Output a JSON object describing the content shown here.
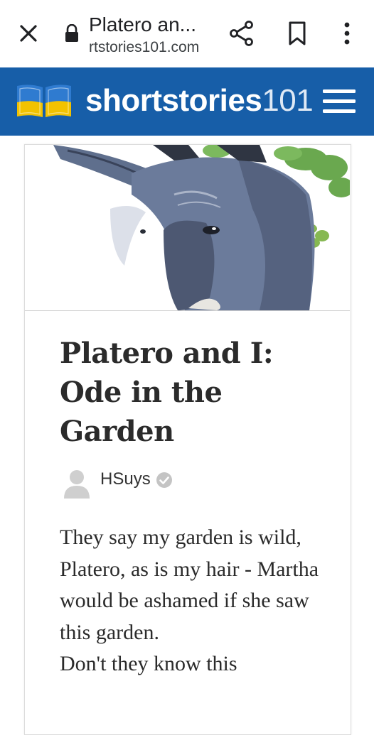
{
  "browser": {
    "title": "Platero an...",
    "url": "rtstories101.com",
    "icons": {
      "close": "close-icon",
      "lock": "lock-icon",
      "share": "share-icon",
      "bookmark": "bookmark-icon",
      "more": "more-vert-icon"
    }
  },
  "site": {
    "brand": "shortstories",
    "brand_number": "101",
    "header_color": "#175ea8",
    "logo_colors": [
      "#2f7bd0",
      "#f2c200"
    ]
  },
  "article": {
    "image_alt": "donkey illustration",
    "title": "Platero and I: Ode in the Garden",
    "author": "HSuys",
    "body": [
      "They say my garden is wild, Platero, as is my hair - Martha would be ashamed if she saw this garden.",
      "Don't they know this"
    ]
  }
}
